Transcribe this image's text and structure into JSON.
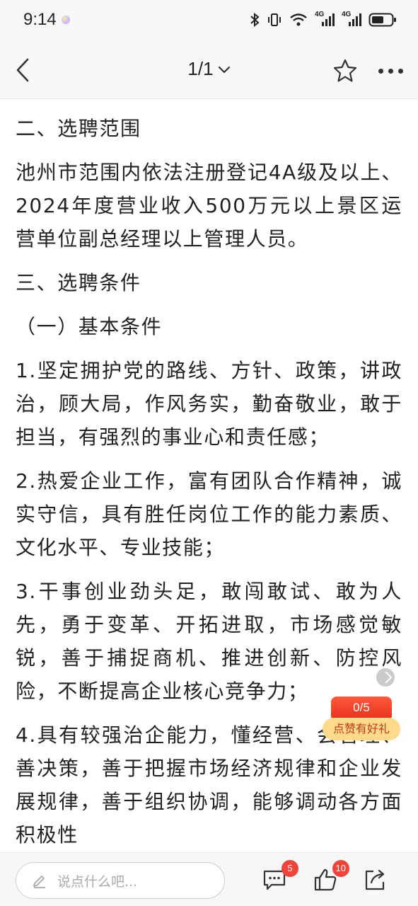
{
  "status_bar": {
    "time": "9:14",
    "network_1": "4G",
    "network_2": "4G"
  },
  "nav": {
    "page_indicator": "1/1"
  },
  "article": {
    "paragraphs": [
      "二、选聘范围",
      "池州市范围内依法注册登记4A级及以上、2024年度营业收入500万元以上景区运营单位副总经理以上管理人员。",
      "三、选聘条件",
      "（一）基本条件",
      "1.坚定拥护党的路线、方针、政策，讲政治，顾大局，作风务实，勤奋敬业，敢于担当，有强烈的事业心和责任感；",
      "2.热爱企业工作，富有团队合作精神，诚实守信，具有胜任岗位工作的能力素质、文化水平、专业技能；",
      "3.干事创业劲头足，敢闯敢试、敢为人先，勇于变革、开拓进取，市场感觉敏锐，善于捕捉商机、推进创新、防控风险，不断提高企业核心竞争力；",
      "4.具有较强治企能力，懂经营、会管理、善决策，善于把握市场经济规律和企业发展规律，善于组织协调，能够调动各方面积极性"
    ]
  },
  "like_promo": {
    "count": "0/5",
    "text": "点赞有好礼"
  },
  "bottom_bar": {
    "comment_placeholder": "说点什么吧...",
    "comment_badge": "5",
    "like_badge": "10"
  },
  "colors": {
    "accent_red": "#f04438",
    "promo_yellow": "#ffd98c",
    "bar_bg": "#f7f7f7"
  }
}
